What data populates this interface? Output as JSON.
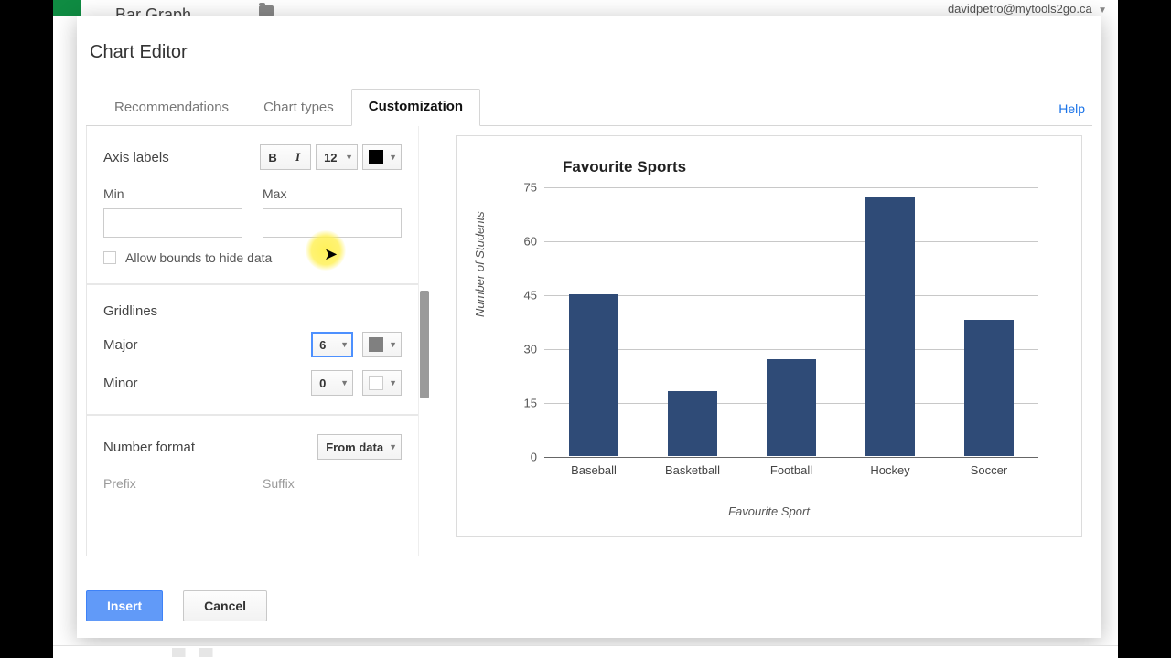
{
  "user_email": "davidpetro@mytools2go.ca",
  "doc_title": "Bar Graph",
  "modal": {
    "title": "Chart Editor",
    "tabs": {
      "recommendations": "Recommendations",
      "types": "Chart types",
      "custom": "Customization"
    },
    "help": "Help",
    "axis_labels": "Axis labels",
    "font_size": "12",
    "min_label": "Min",
    "max_label": "Max",
    "min_value": "",
    "max_value": "",
    "allow_bounds": "Allow bounds to hide data",
    "gridlines": "Gridlines",
    "major_label": "Major",
    "major_value": "6",
    "minor_label": "Minor",
    "minor_value": "0",
    "number_format": "Number format",
    "from_data": "From data",
    "prefix": "Prefix",
    "suffix": "Suffix",
    "insert": "Insert",
    "cancel": "Cancel"
  },
  "chart_data": {
    "type": "bar",
    "title": "Favourite Sports",
    "xlabel": "Favourite Sport",
    "ylabel": "Number of Students",
    "categories": [
      "Baseball",
      "Basketball",
      "Football",
      "Hockey",
      "Soccer"
    ],
    "values": [
      45,
      18,
      27,
      72,
      38
    ],
    "ylim": [
      0,
      75
    ],
    "y_ticks": [
      0,
      15,
      30,
      45,
      60,
      75
    ]
  },
  "colors": {
    "bar": "#2f4b77",
    "axis_text_color": "#000000",
    "major_grid_color": "#808080",
    "minor_grid_color": "#ffffff"
  }
}
